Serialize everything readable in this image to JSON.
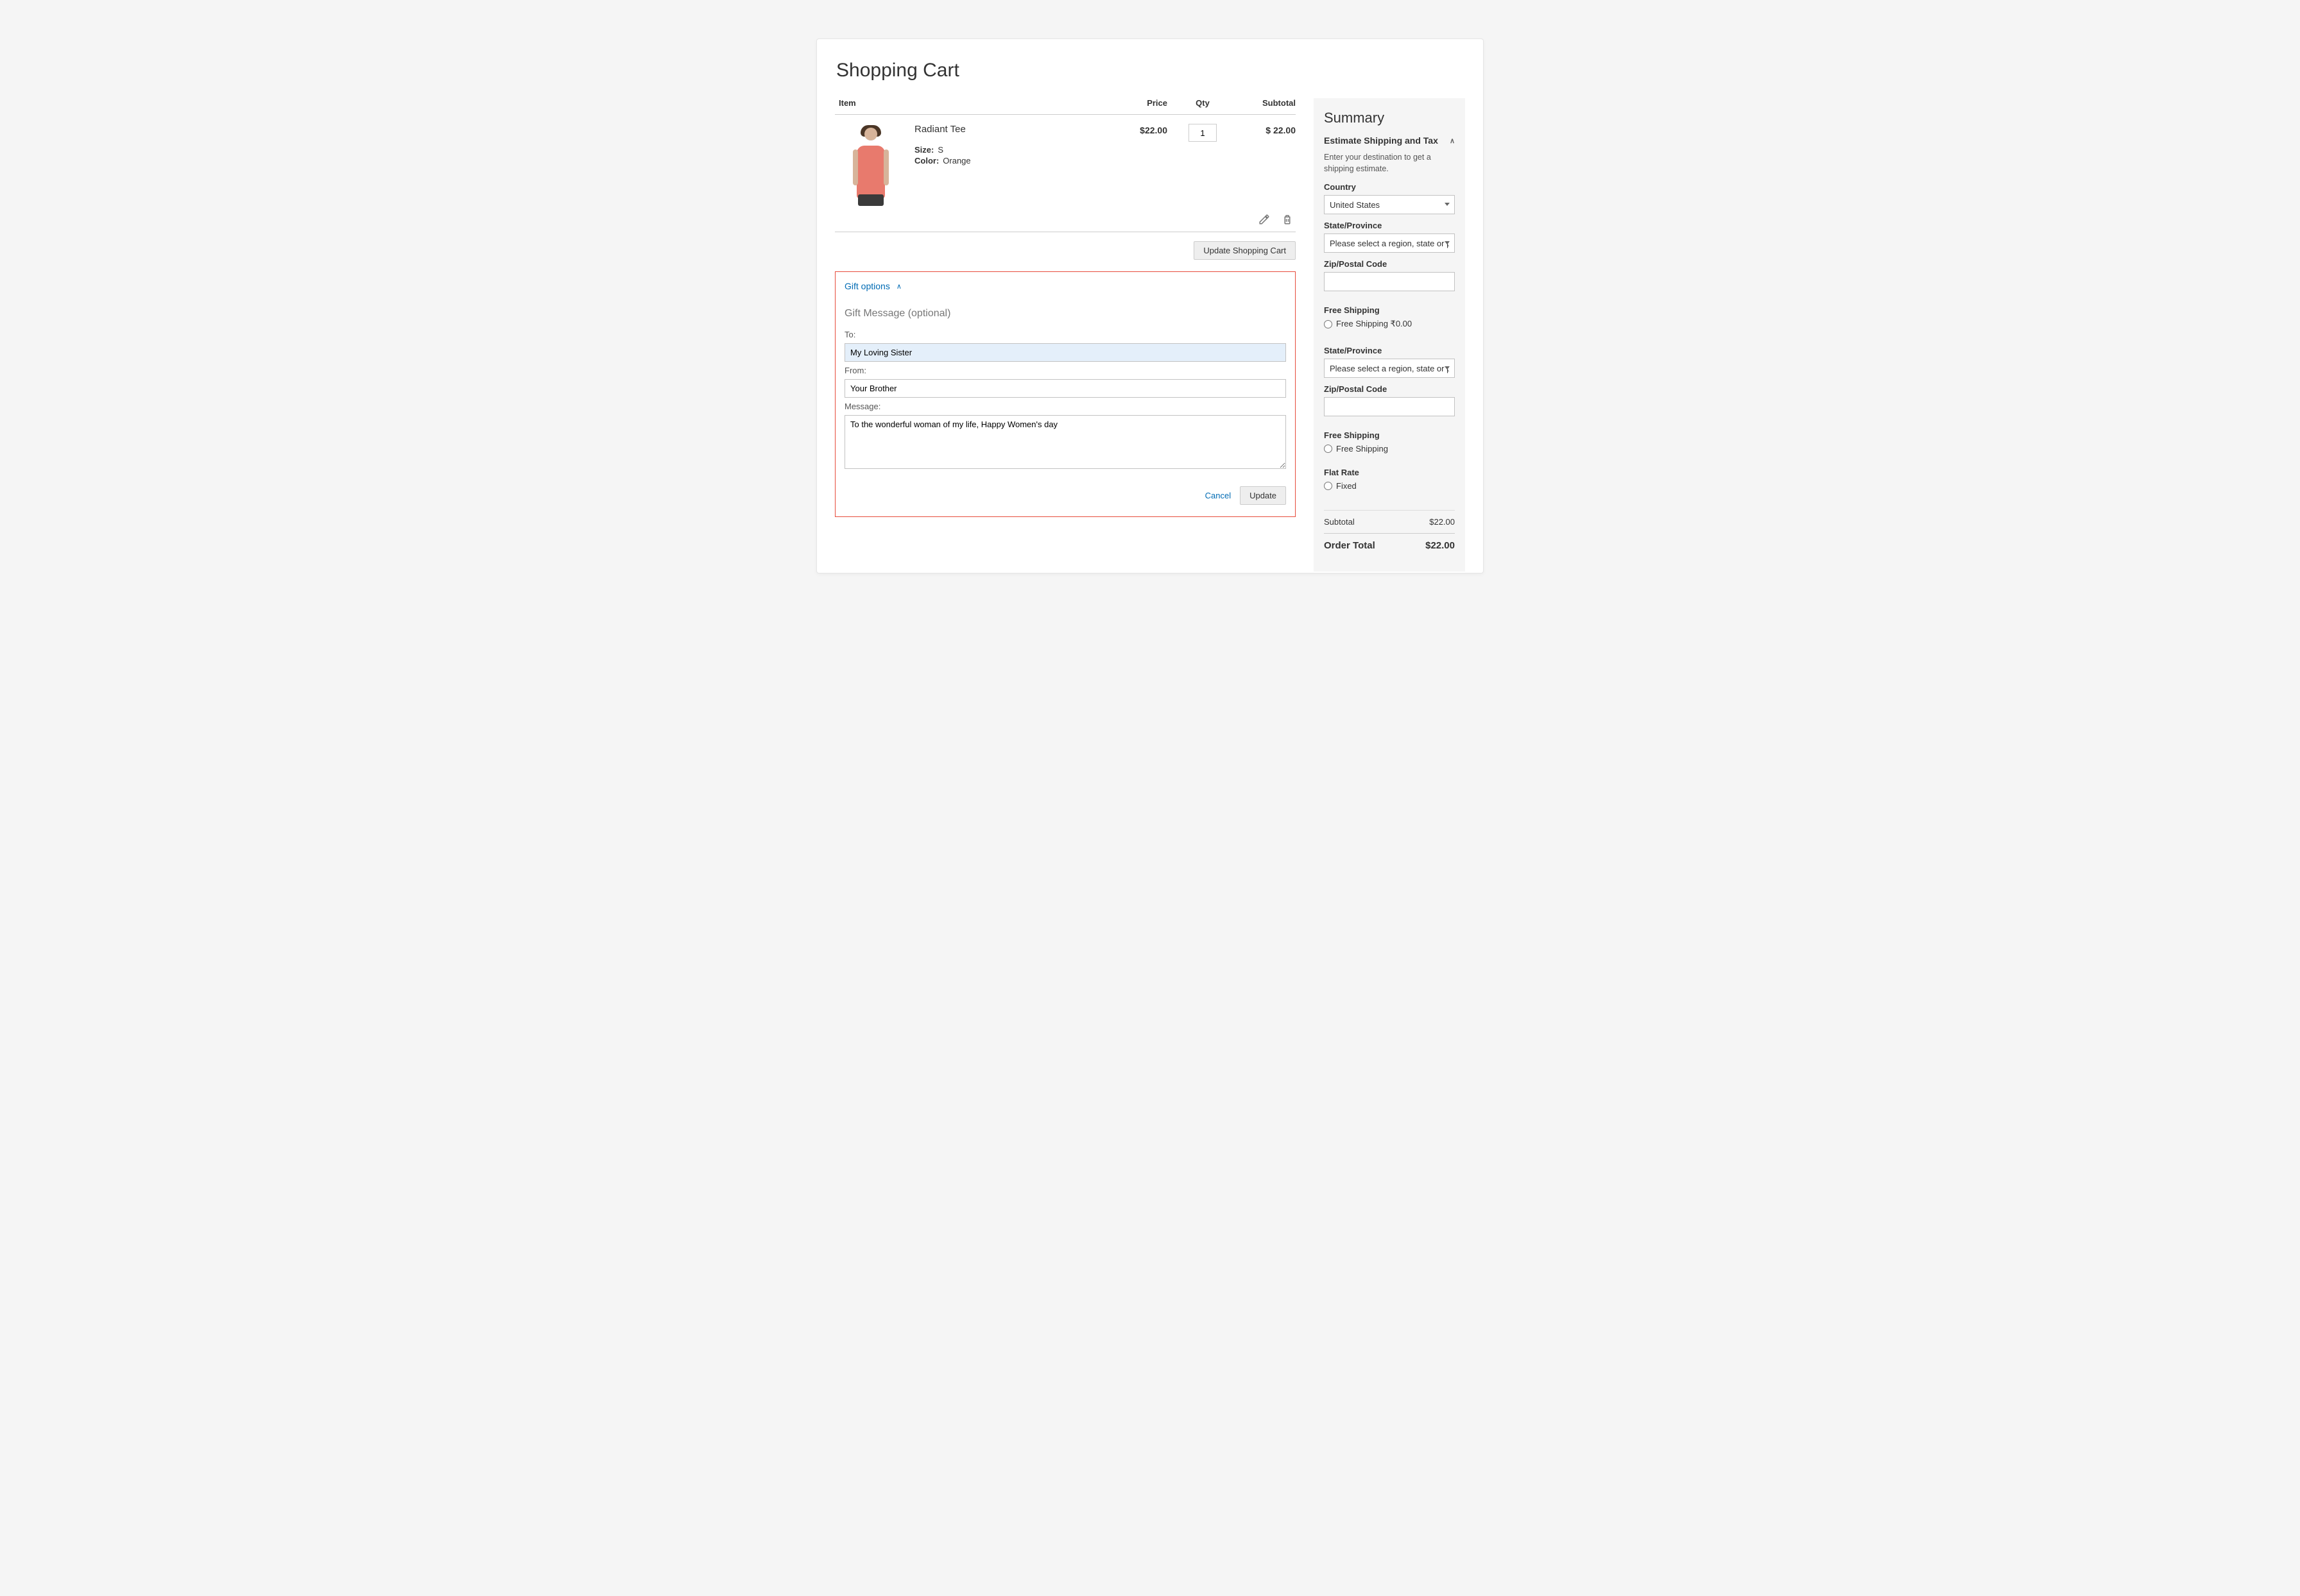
{
  "page_title": "Shopping Cart",
  "columns": {
    "item": "Item",
    "price": "Price",
    "qty": "Qty",
    "subtotal": "Subtotal"
  },
  "cart_item": {
    "name": "Radiant Tee",
    "size_label": "Size:",
    "size_value": "S",
    "color_label": "Color:",
    "color_value": "Orange",
    "price": "$22.00",
    "qty": "1",
    "subtotal": "$ 22.00"
  },
  "update_cart_label": "Update Shopping Cart",
  "gift": {
    "toggle_label": "Gift options",
    "section_heading": "Gift Message (optional)",
    "to_label": "To:",
    "to_value": "My Loving Sister",
    "from_label": "From:",
    "from_value": "Your Brother",
    "message_label": "Message:",
    "message_value": "To the wonderful woman of my life, Happy Women's day",
    "cancel_label": "Cancel",
    "update_label": "Update"
  },
  "summary": {
    "title": "Summary",
    "estimate_title": "Estimate Shipping and Tax",
    "estimate_help": "Enter your destination to get a shipping estimate.",
    "country_label": "Country",
    "country_value": "United States",
    "state_label": "State/Province",
    "state_placeholder": "Please select a region, state or province",
    "zip_label": "Zip/Postal Code",
    "free_ship_title": "Free Shipping",
    "free_ship_option": "Free Shipping ₹0.00",
    "free_ship_option_plain": "Free Shipping",
    "flat_rate_title": "Flat Rate",
    "flat_rate_option": "Fixed",
    "subtotal_label": "Subtotal",
    "subtotal_value": "$22.00",
    "order_total_label": "Order Total",
    "order_total_value": "$22.00"
  }
}
